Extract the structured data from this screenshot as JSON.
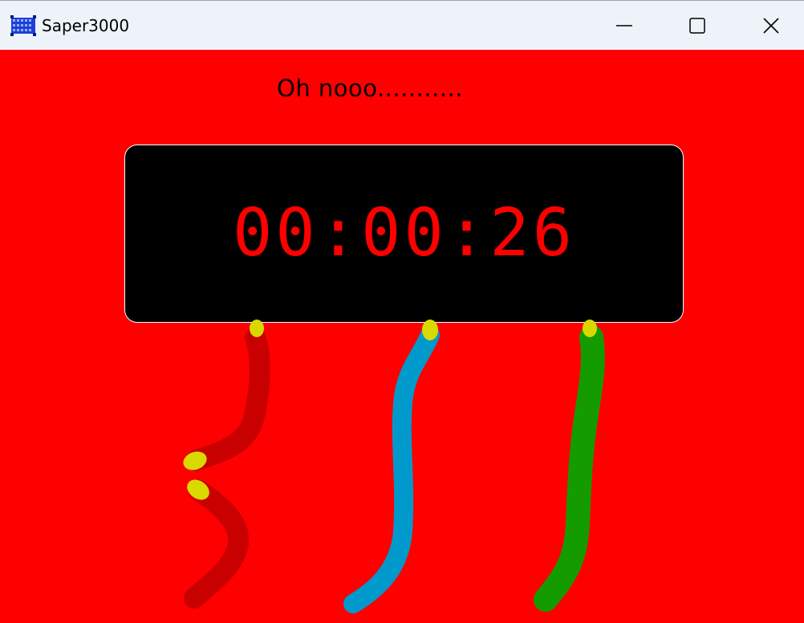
{
  "window": {
    "title": "Saper3000",
    "controls": {
      "minimize_icon": "minimize-icon",
      "maximize_icon": "maximize-icon",
      "close_icon": "close-icon"
    }
  },
  "main": {
    "message": "Oh nooo...........",
    "timer": "00:00:26",
    "wires": [
      {
        "name": "red-wire",
        "color": "#c80000",
        "state": "cut"
      },
      {
        "name": "blue-wire",
        "color": "#0099cc",
        "state": "intact"
      },
      {
        "name": "green-wire",
        "color": "#149b00",
        "state": "intact"
      }
    ],
    "colors": {
      "background": "#ff0000",
      "panel": "#000000",
      "timer_text": "#ff0000",
      "wire_tip": "#d9d900"
    }
  }
}
